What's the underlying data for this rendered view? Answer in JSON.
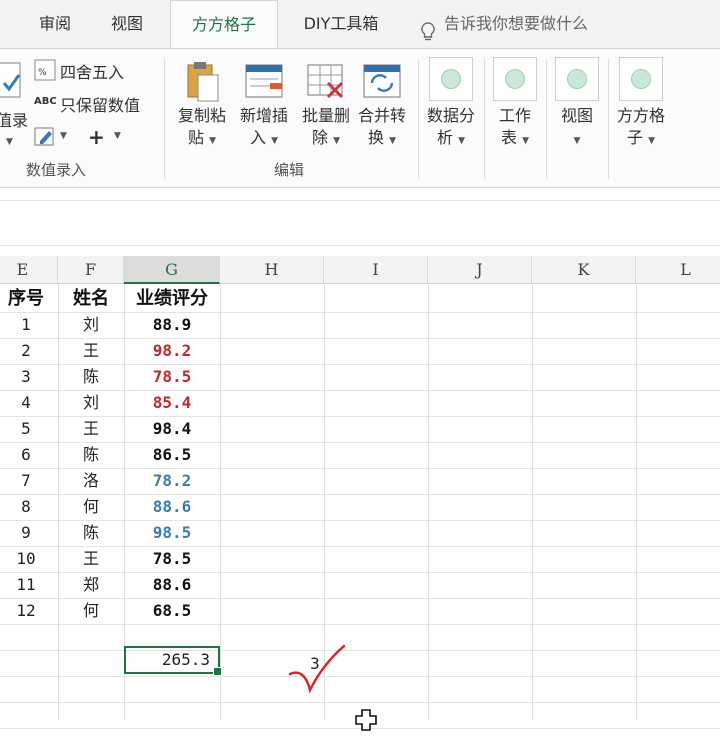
{
  "tabs": [
    {
      "label": "审阅",
      "active": false
    },
    {
      "label": "视图",
      "active": false
    },
    {
      "label": "方方格子",
      "active": true
    },
    {
      "label": "DIY工具箱",
      "active": false
    }
  ],
  "tell_me": "告诉我你想要做什么",
  "ribbon": {
    "group1": {
      "partial_big_label": "值录",
      "items": [
        "四舍五入",
        "只保留数值"
      ],
      "small_plus": "+",
      "label": "数值录入"
    },
    "group2": {
      "buttons": [
        {
          "line1": "复制粘",
          "line2": "贴"
        },
        {
          "line1": "新增插",
          "line2": "入"
        },
        {
          "line1": "批量删",
          "line2": "除"
        },
        {
          "line1": "合并转",
          "line2": "换"
        }
      ],
      "label": "编辑"
    },
    "group3": {
      "buttons": [
        {
          "line1": "数据分",
          "line2": "析"
        },
        {
          "line1": "工作",
          "line2": "表"
        },
        {
          "line1": "视图",
          "line2": ""
        },
        {
          "line1": "方方格",
          "line2": "子"
        }
      ]
    }
  },
  "sheet": {
    "columns": [
      "E",
      "F",
      "G",
      "H",
      "I",
      "J",
      "K",
      "L"
    ],
    "selected_column": "G",
    "headers": [
      "序号",
      "姓名",
      "业绩评分"
    ],
    "rows": [
      {
        "no": "1",
        "name": "刘",
        "score": "88.9",
        "color": "#111111"
      },
      {
        "no": "2",
        "name": "王",
        "score": "98.2",
        "color": "#c0282d"
      },
      {
        "no": "3",
        "name": "陈",
        "score": "78.5",
        "color": "#c0282d"
      },
      {
        "no": "4",
        "name": "刘",
        "score": "85.4",
        "color": "#c0282d"
      },
      {
        "no": "5",
        "name": "王",
        "score": "98.4",
        "color": "#111111"
      },
      {
        "no": "6",
        "name": "陈",
        "score": "86.5",
        "color": "#111111"
      },
      {
        "no": "7",
        "name": "洛",
        "score": "78.2",
        "color": "#3b7ab8"
      },
      {
        "no": "8",
        "name": "何",
        "score": "88.6",
        "color": "#3b7ab8"
      },
      {
        "no": "9",
        "name": "陈",
        "score": "98.5",
        "color": "#3b7ab8"
      },
      {
        "no": "10",
        "name": "王",
        "score": "78.5",
        "color": "#111111"
      },
      {
        "no": "11",
        "name": "郑",
        "score": "88.6",
        "color": "#111111"
      },
      {
        "no": "12",
        "name": "何",
        "score": "68.5",
        "color": "#111111"
      }
    ],
    "sum_value": "265.3",
    "count_value": "3"
  },
  "accent_color": "#217346"
}
